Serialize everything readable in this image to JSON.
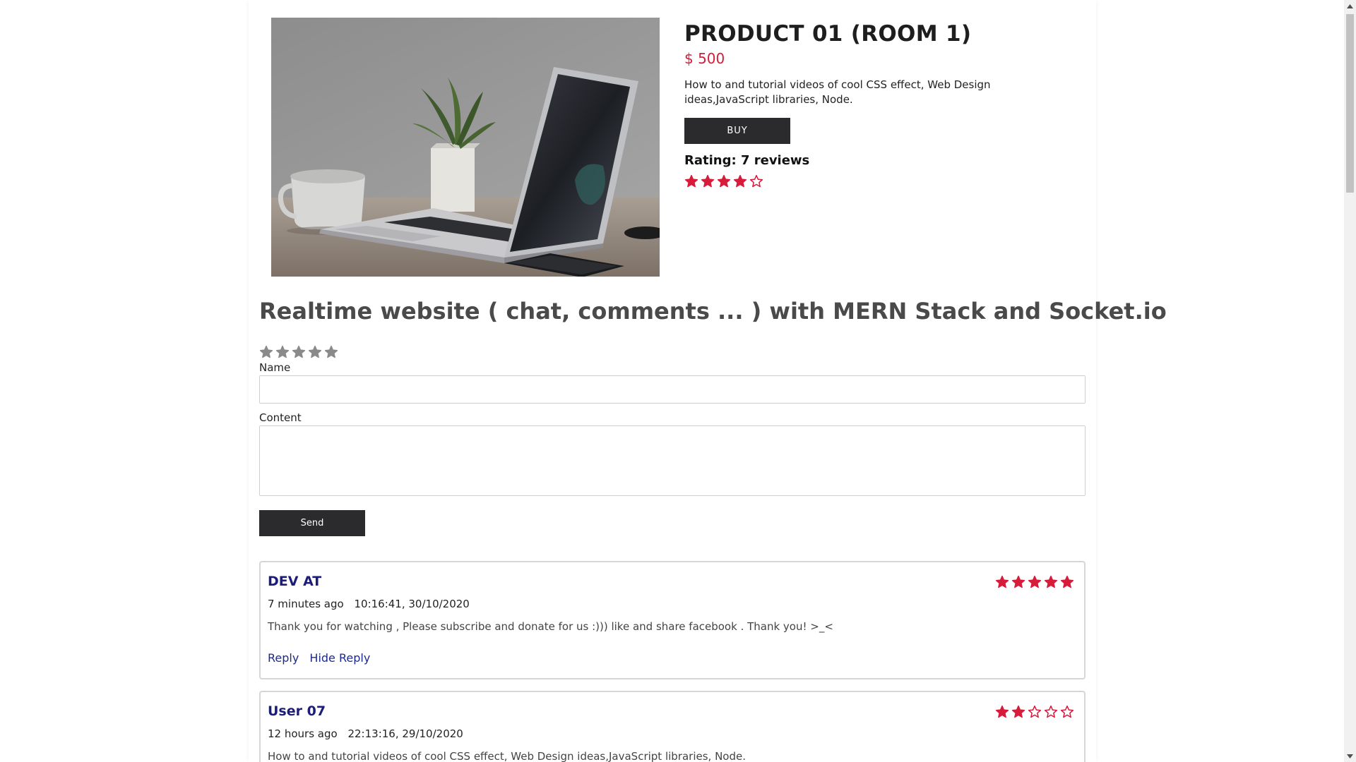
{
  "product": {
    "title": "PRODUCT 01 (ROOM 1)",
    "price": "$ 500",
    "description": "How to and tutorial videos of cool CSS effect, Web Design ideas,JavaScript libraries, Node.",
    "buy_label": "BUY",
    "rating_label": "Rating: 7 reviews",
    "rating_stars": 4,
    "image": "laptop-on-desk-photo"
  },
  "section_title": "Realtime website ( chat, comments ... ) with MERN Stack and Socket.io",
  "form": {
    "rating_stars": 0,
    "name_label": "Name",
    "name_value": "",
    "content_label": "Content",
    "content_value": "",
    "send_label": "Send"
  },
  "comments": [
    {
      "author": "DEV AT",
      "relative_time": "7 minutes ago",
      "timestamp": "10:16:41, 30/10/2020",
      "text": "Thank you for watching , Please subscribe and donate for us :))) like and share facebook . Thank you! >_<",
      "stars": 5,
      "reply_label": "Reply",
      "hide_reply_label": "Hide Reply"
    },
    {
      "author": "User 07",
      "relative_time": "12 hours ago",
      "timestamp": "22:13:16, 29/10/2020",
      "text": "How to and tutorial videos of cool CSS effect, Web Design ideas,JavaScript libraries, Node.",
      "stars": 2
    }
  ],
  "colors": {
    "accent": "#d61c3a",
    "button": "#2b2b2d",
    "author": "#1c1c7a",
    "link": "#1c2a8c",
    "empty_star": "#8a8a8a"
  }
}
